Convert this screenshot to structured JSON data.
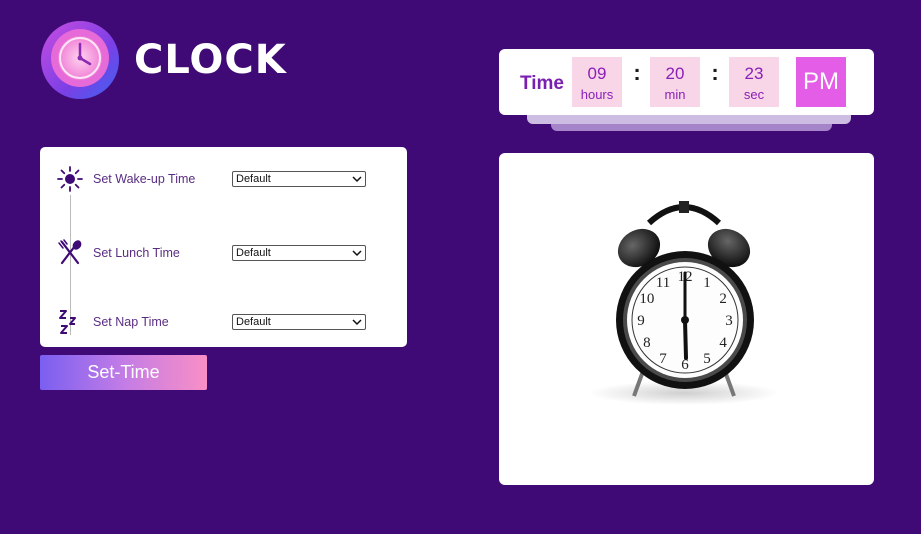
{
  "app": {
    "title": "CLOCK",
    "logo_icon": "clock-icon"
  },
  "time_display": {
    "label": "Time",
    "hours": "09",
    "hours_unit": "hours",
    "minutes": "20",
    "minutes_unit": "min",
    "seconds": "23",
    "seconds_unit": "sec",
    "separator": ":",
    "period": "PM"
  },
  "settings": {
    "rows": [
      {
        "icon": "sun-icon",
        "label": "Set Wake-up Time",
        "selected": "Default"
      },
      {
        "icon": "fork-spoon-icon",
        "label": "Set Lunch Time",
        "selected": "Default"
      },
      {
        "icon": "sleep-zzz-icon",
        "label": "Set Nap Time",
        "selected": "Default"
      }
    ],
    "submit_label": "Set-Time"
  },
  "image": {
    "subject": "alarm-clock-image",
    "dial_numbers": [
      "12",
      "1",
      "2",
      "3",
      "4",
      "5",
      "6",
      "7",
      "8",
      "9",
      "10",
      "11"
    ]
  },
  "colors": {
    "background": "#3f0a75",
    "accent": "#e35de6",
    "time_box": "#f8d6e8",
    "label_purple": "#7a1fb0"
  }
}
